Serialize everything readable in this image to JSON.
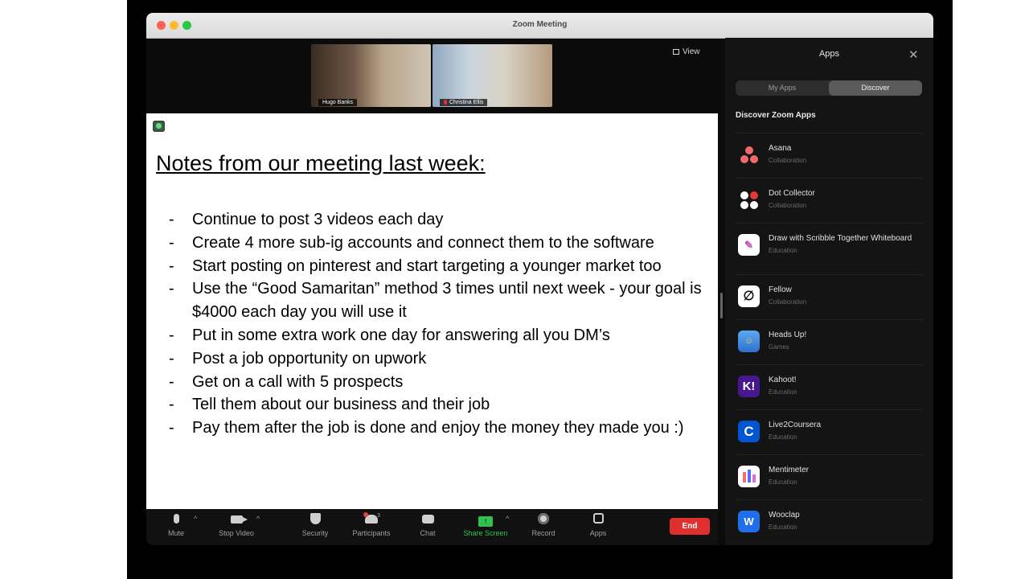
{
  "window": {
    "title": "Zoom Meeting"
  },
  "participants": [
    {
      "name": "Hugo Banks",
      "muted": false
    },
    {
      "name": "Christina Ellis",
      "muted": true
    }
  ],
  "view_label": "View",
  "slide": {
    "title": "Notes from our meeting last week:",
    "items": [
      "Continue to post 3 videos each day",
      "Create 4 more sub-ig accounts and connect them to the software",
      "Start posting on pinterest and start targeting a younger market too",
      "Use the “Good Samaritan” method 3 times until next week - your goal is $4000 each day you will use it",
      "Put in some extra work one day for answering all you DM’s",
      "Post a job opportunity on upwork",
      "Get on a call with 5 prospects",
      "Tell them about our business and their job",
      "Pay them after the job is done and enjoy the money they made you :)"
    ]
  },
  "toolbar": {
    "mute": "Mute",
    "stop_video": "Stop Video",
    "security": "Security",
    "participants": "Participants",
    "participants_count": "3",
    "chat": "Chat",
    "share_screen": "Share Screen",
    "record": "Record",
    "apps": "Apps",
    "end": "End"
  },
  "apps_panel": {
    "title": "Apps",
    "tabs": [
      "My Apps",
      "Discover"
    ],
    "active_tab": "Discover",
    "section_title": "Discover Zoom Apps",
    "apps": [
      {
        "name": "Asana",
        "category": "Collaboration",
        "icon": "asana-icon",
        "color": "#f06a6a"
      },
      {
        "name": "Dot Collector",
        "category": "Collaboration",
        "icon": "dot-collector-icon",
        "color": "#e53935"
      },
      {
        "name": "Draw with Scribble Together Whiteboard",
        "category": "Education",
        "icon": "scribble-icon",
        "color": "#ffffff"
      },
      {
        "name": "Fellow",
        "category": "Collaboration",
        "icon": "fellow-icon",
        "color": "#ffffff"
      },
      {
        "name": "Heads Up!",
        "category": "Games",
        "icon": "heads-up-icon",
        "color": "#3a8ee6"
      },
      {
        "name": "Kahoot!",
        "category": "Education",
        "icon": "kahoot-icon",
        "color": "#46178f"
      },
      {
        "name": "Live2Coursera",
        "category": "Education",
        "icon": "coursera-icon",
        "color": "#0056d2"
      },
      {
        "name": "Mentimeter",
        "category": "Education",
        "icon": "mentimeter-icon",
        "color": "#ffffff"
      },
      {
        "name": "Wooclap",
        "category": "Education",
        "icon": "wooclap-icon",
        "color": "#1f6feb"
      }
    ]
  }
}
